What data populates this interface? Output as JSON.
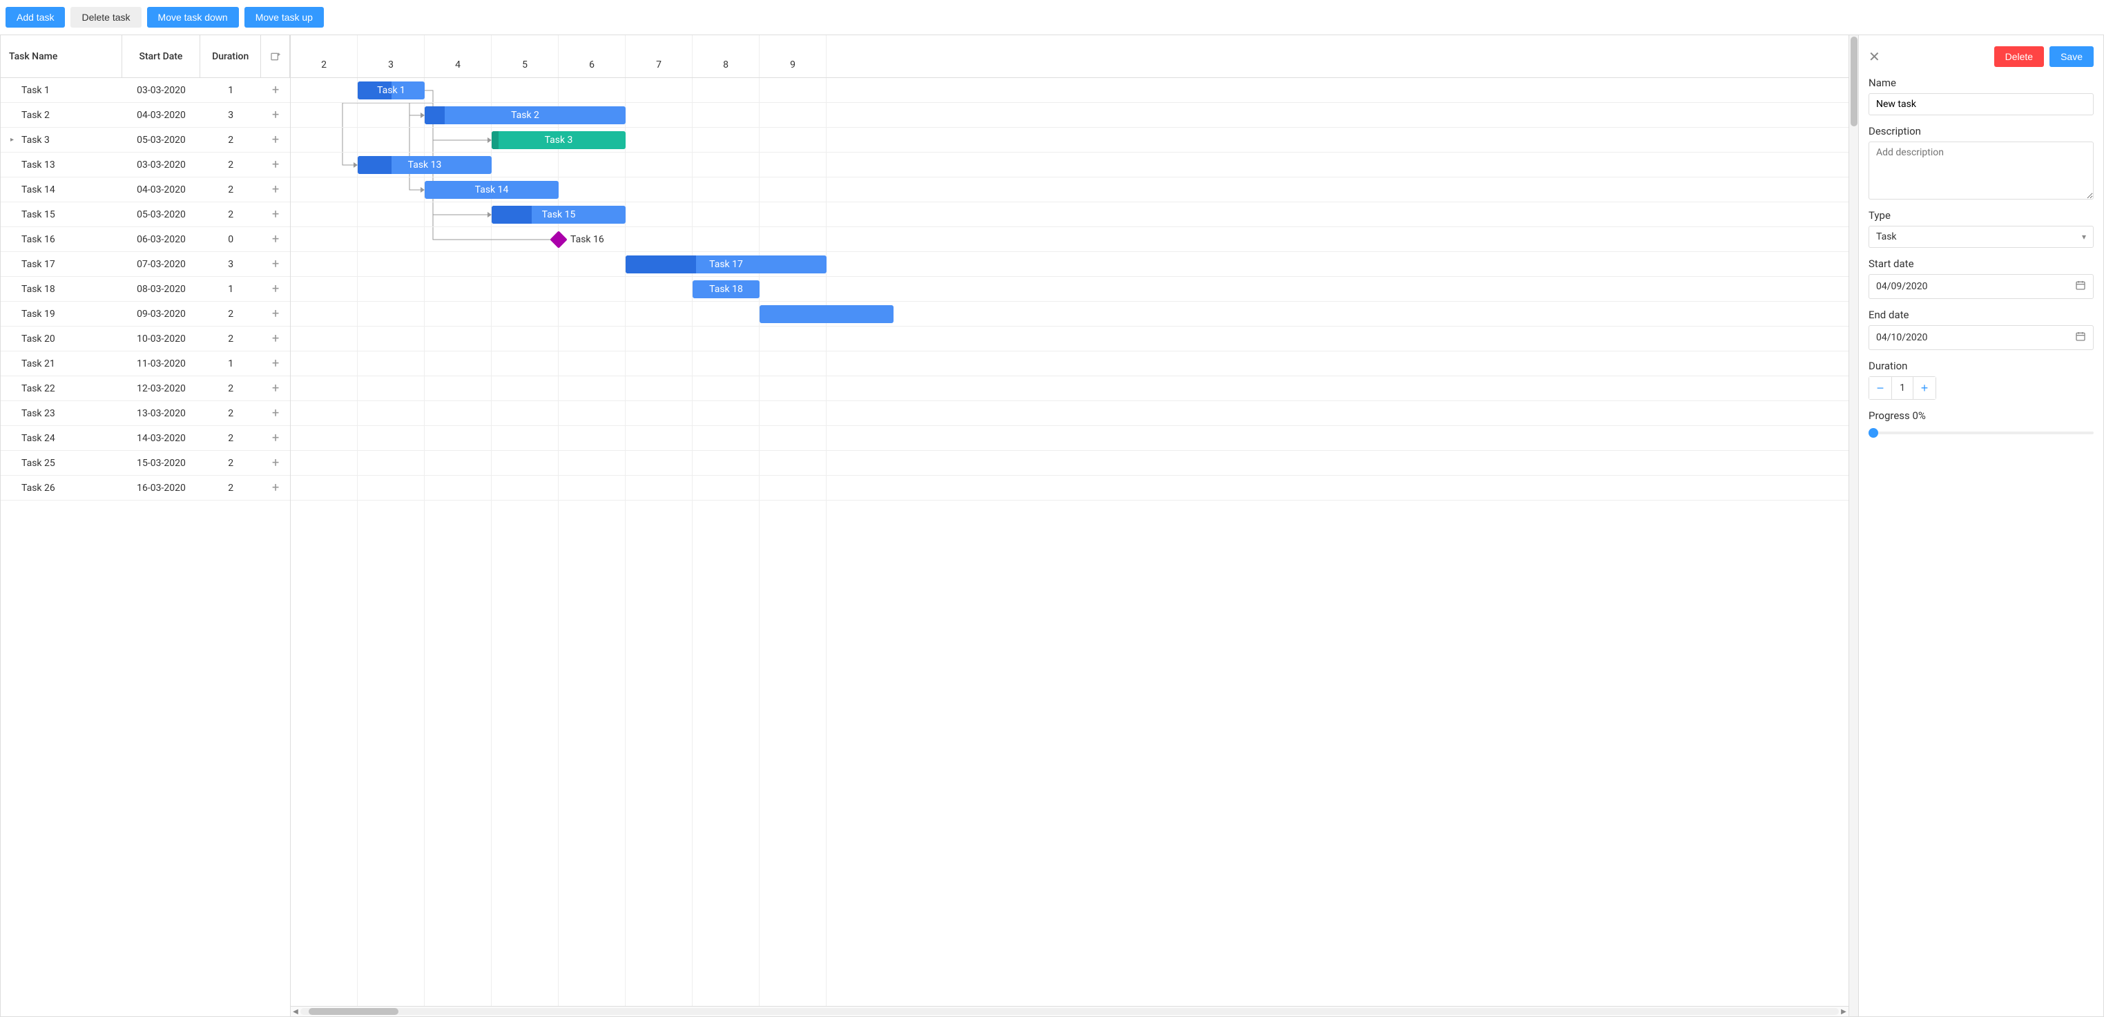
{
  "toolbar": {
    "add": "Add task",
    "delete": "Delete task",
    "down": "Move task down",
    "up": "Move task up"
  },
  "grid": {
    "headers": {
      "name": "Task Name",
      "start": "Start Date",
      "duration": "Duration"
    },
    "rows": [
      {
        "name": "Task 1",
        "start": "03-03-2020",
        "duration": "1",
        "has_children": false
      },
      {
        "name": "Task 2",
        "start": "04-03-2020",
        "duration": "3",
        "has_children": false
      },
      {
        "name": "Task 3",
        "start": "05-03-2020",
        "duration": "2",
        "has_children": true
      },
      {
        "name": "Task 13",
        "start": "03-03-2020",
        "duration": "2",
        "has_children": false
      },
      {
        "name": "Task 14",
        "start": "04-03-2020",
        "duration": "2",
        "has_children": false
      },
      {
        "name": "Task 15",
        "start": "05-03-2020",
        "duration": "2",
        "has_children": false
      },
      {
        "name": "Task 16",
        "start": "06-03-2020",
        "duration": "0",
        "has_children": false
      },
      {
        "name": "Task 17",
        "start": "07-03-2020",
        "duration": "3",
        "has_children": false
      },
      {
        "name": "Task 18",
        "start": "08-03-2020",
        "duration": "1",
        "has_children": false
      },
      {
        "name": "Task 19",
        "start": "09-03-2020",
        "duration": "2",
        "has_children": false
      },
      {
        "name": "Task 20",
        "start": "10-03-2020",
        "duration": "2",
        "has_children": false
      },
      {
        "name": "Task 21",
        "start": "11-03-2020",
        "duration": "1",
        "has_children": false
      },
      {
        "name": "Task 22",
        "start": "12-03-2020",
        "duration": "2",
        "has_children": false
      },
      {
        "name": "Task 23",
        "start": "13-03-2020",
        "duration": "2",
        "has_children": false
      },
      {
        "name": "Task 24",
        "start": "14-03-2020",
        "duration": "2",
        "has_children": false
      },
      {
        "name": "Task 25",
        "start": "15-03-2020",
        "duration": "2",
        "has_children": false
      },
      {
        "name": "Task 26",
        "start": "16-03-2020",
        "duration": "2",
        "has_children": false
      }
    ]
  },
  "timescale": [
    "2",
    "3",
    "4",
    "5",
    "6",
    "7",
    "8",
    "9"
  ],
  "chart_data": {
    "type": "bar",
    "x_unit": "day",
    "xlim": [
      2,
      9
    ],
    "rows": [
      {
        "label": "Task 1",
        "start": 3,
        "end": 4,
        "progress": 0.5,
        "color": "blue"
      },
      {
        "label": "Task 2",
        "start": 4,
        "end": 7,
        "progress": 0.1,
        "color": "blue"
      },
      {
        "label": "Task 3",
        "start": 5,
        "end": 7,
        "progress": 0.05,
        "color": "green"
      },
      {
        "label": "Task 13",
        "start": 3,
        "end": 5,
        "progress": 0.25,
        "color": "blue"
      },
      {
        "label": "Task 14",
        "start": 4,
        "end": 6,
        "progress": 0.0,
        "color": "blue"
      },
      {
        "label": "Task 15",
        "start": 5,
        "end": 7,
        "progress": 0.3,
        "color": "blue"
      },
      {
        "label": "Task 16",
        "start": 6,
        "milestone": true,
        "color": "magenta"
      },
      {
        "label": "Task 17",
        "start": 7,
        "end": 10,
        "progress": 0.35,
        "color": "blue"
      },
      {
        "label": "Task 18",
        "start": 8,
        "end": 9,
        "progress": 0.0,
        "color": "blue"
      },
      {
        "label": "",
        "start": 9,
        "end": 11,
        "progress": 0.0,
        "color": "blue"
      }
    ],
    "links": [
      {
        "from": 0,
        "to": 1
      },
      {
        "from": 0,
        "to": 2
      },
      {
        "from": 0,
        "to": 3
      },
      {
        "from": 0,
        "to": 4
      },
      {
        "from": 0,
        "to": 5
      },
      {
        "from": 0,
        "to": 6
      }
    ]
  },
  "panel": {
    "delete": "Delete",
    "save": "Save",
    "name_label": "Name",
    "name_value": "New task",
    "desc_label": "Description",
    "desc_placeholder": "Add description",
    "type_label": "Type",
    "type_value": "Task",
    "start_label": "Start date",
    "start_value": "04/09/2020",
    "end_label": "End date",
    "end_value": "04/10/2020",
    "duration_label": "Duration",
    "duration_value": "1",
    "progress_label": "Progress 0%"
  }
}
